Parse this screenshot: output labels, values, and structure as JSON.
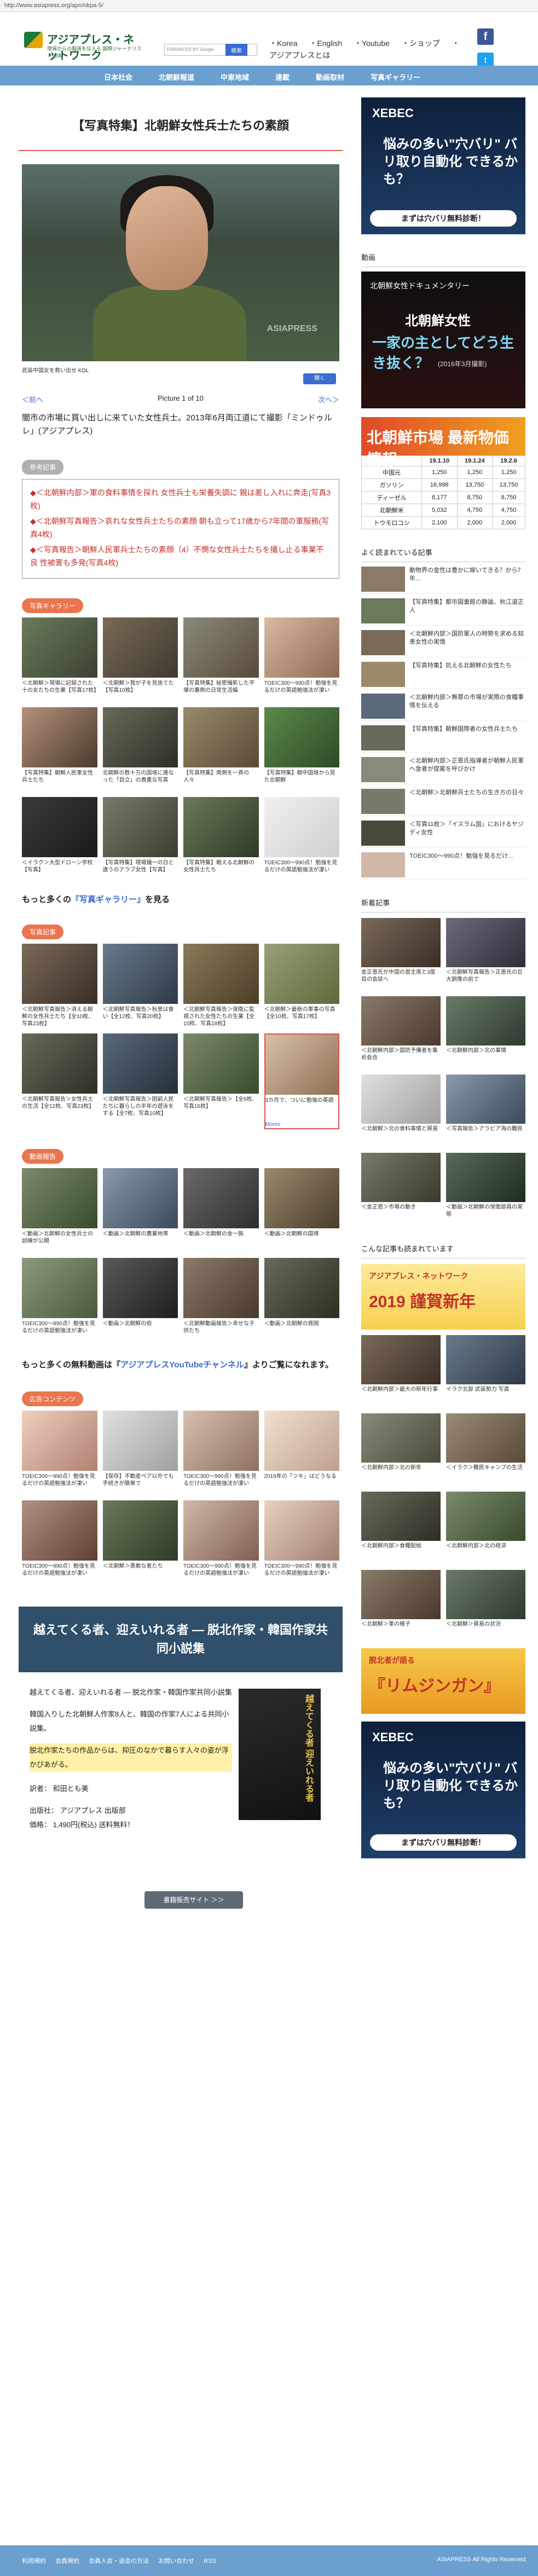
{
  "url": "http://www.asiapress.org/apn/nkpa-5/",
  "brand": {
    "name": "アジアプレス・ネットワーク",
    "tagline": "現場からの報道を伝える 国際ジャーナリスト団体"
  },
  "search": {
    "placeholder": "ENHANCED BY Google",
    "button": "検索"
  },
  "toplinks": [
    "・Korea",
    "・English",
    "・Youtube",
    "・ショップ",
    "・アジアプレスとは"
  ],
  "nav": [
    "日本社会",
    "北朝鮮報道",
    "中東地域",
    "連載",
    "動画取材",
    "写真ギャラリー"
  ],
  "article": {
    "title": "【写真特集】北朝鮮女性兵士たちの素顔",
    "watermark": "ASIAPRESS",
    "ad_text": "武装中国女を救い出せ KDL",
    "ad_button": "開く",
    "pager_prev": "＜前へ",
    "pager_count": "Picture 1 of 10",
    "pager_next": "次へ＞",
    "caption": "闇市の市場に買い出しに来ていた女性兵士。2013年6月両江道にて撮影「ミンドゥルレ」(アジアプレス)"
  },
  "refs": {
    "label": "参考記事",
    "items": [
      "◆＜北朝鮮内部＞軍の食料事情を探れ 女性兵士も栄養失調に 親は差し入れに奔走(写真3枚)",
      "◆＜北朝鮮写真報告＞哀れな女性兵士たちの素顔 朝も立って17歳から7年間の軍服務(写真4枚)",
      "◆＜写真報告＞朝鮮人民軍兵士たちの素顔（4）不憫な女性兵士たちを撮し止る事業不良 性被害も多発(写真4枚)"
    ]
  },
  "gallery1": {
    "label": "写真ギャラリー",
    "items": [
      "＜北朝鮮＞現場に記録された十の女たちの生業【写真17枚】",
      "＜北朝鮮＞我が子を見捨てた【写真10枚】",
      "【写真特集】秘密撮影した平壌の裏側の日常生活編",
      "TOEIC300〜990点！勉強を見るだけの英語勉強法が凄い",
      "【写真特集】朝鮮人民軍女性兵士たち",
      "北朝鮮の数十万の国境に連なった「目立」の貴重な写真",
      "【写真特集】両側を一斉の人々",
      "【写真特集】朝中国境から見た北朝鮮",
      "＜イラク＞大型ドローン学校【写真】",
      "【写真特集】現場撮一の日と違うのアラブ女性【写真】",
      "【写真特集】戦える北朝鮮の女性兵士たち",
      "TOEIC300〜990点！勉強を見るだけの英語勉強法が凄い"
    ],
    "sponsor": "Sponsored"
  },
  "more": {
    "prefix": "もっと多くの",
    "link": "『写真ギャラリー』",
    "suffix": "を見る"
  },
  "gallery2": {
    "label": "写真記事",
    "items": [
      "＜北朝鮮写真報告＞消える朝鮮の女性兵士たち【全10枚、写真23枚】",
      "＜北朝鮮写真報告＞秋景は食い【全12枚、写真20枚】",
      "＜北朝鮮写真報告＞保衛に監視された女性たちの生業【全10枚、写真18枚】",
      "＜北朝鮮＞最新の軍事の写真【全10枚、写真17枚】",
      "＜北朝鮮写真報告＞女性兵士の生活【全12枚、写真23枚】",
      "＜北朝鮮写真報告＞困窮人民たちに暮らしの半年の遊泳をする【全7枚、写真10枚】",
      "＜北朝鮮写真報告＞【全6枚、写真16枚】",
      "3カ月で、ついに勉強の英語"
    ],
    "more_label": "Mores"
  },
  "gallery3": {
    "label": "動画報告",
    "items": [
      "＜動画＞北朝鮮の女性兵士の訓練が公開",
      "＜動画＞北朝鮮の農業地帯",
      "＜動画＞北朝鮮の金一族",
      "＜動画＞北朝鮮の国境",
      "TOEIC300〜990点！勉強を見るだけの英語勉強法が凄い",
      "＜動画＞北朝鮮の街",
      "＜北朝鮮動画報告＞幸せな子供たち",
      "＜動画＞北朝鮮の貧困"
    ]
  },
  "youtube": {
    "prefix": "もっと多くの無料動画は『",
    "link": "アジアプレスYouTubeチャンネル",
    "suffix": "』よりご覧になれます。"
  },
  "sponsored": {
    "label": "広告コンテンツ",
    "items": [
      "TOEIC300〜990点！勉強を見るだけの英語勉強法が凄い",
      "【保存】不動産ペア以外でも手続きが簡単で",
      "TOEIC300〜990点！勉強を見るだけの英語勉強法が凄い",
      "2019年の「ツキ」はどうなる",
      "TOEIC300〜990点！勉強を見るだけの英語勉強法が凄い",
      "＜北朝鮮＞勇敢な者たち",
      "TOEIC300〜990点！勉強を見るだけの英語勉強法が凄い",
      "TOEIC300〜990点！勉強を見るだけの英語勉強法が凄い"
    ]
  },
  "book": {
    "title": "越えてくる者、迎えいれる者 ― 脱北作家・韓国作家共同小説集",
    "lines": [
      "越えてくる者、迎えいれる者 ― 脱北作家・韓国作家共同小説集",
      "韓国入りした北朝鮮人作家8人と、韓国の作家7人による共同小説集。",
      "脱北作家たちの作品からは、抑圧のなかで暮らす人々の姿が浮かびあがる。"
    ],
    "translator": "訳者： 和田とも美",
    "publisher": "出版社： アジアプレス 出版部",
    "price": "価格： 1,490円(税込) 送料無料！",
    "cover_text": "越えてくる者 迎えいれる者",
    "button": "書籍販売サイト ＞＞"
  },
  "side": {
    "banner": {
      "brand": "XEBEC",
      "text": "悩みの多い\"穴バリ\" バリ取り自動化 できるかも？",
      "button": "まずは穴バリ無料診断！"
    },
    "video_head": "動画",
    "video": {
      "brand": "北朝鮮女性ドキュメンタリー",
      "line1": "北朝鮮女性",
      "line2": "一家の主としてどう生き抜く？",
      "date": "(2016年3月撮影)"
    },
    "price": {
      "title": "北朝鮮市場 最新物価情報",
      "headers": [
        "",
        "19.1.10",
        "19.1.24",
        "19.2.6"
      ],
      "rows": [
        [
          "中国元",
          "1,250",
          "1,250",
          "1,250"
        ],
        [
          "ガソリン",
          "16,998",
          "13,750",
          "13,750"
        ],
        [
          "ディーゼル",
          "8,177",
          "8,750",
          "8,750"
        ],
        [
          "北朝鮮米",
          "5,032",
          "4,750",
          "4,750"
        ],
        [
          "トウモロコシ",
          "2,100",
          "2,000",
          "2,000"
        ]
      ]
    },
    "popular_head": "よく読まれている記事",
    "popular": [
      "動物界の金性は豊かに嫁いできる？から7年…",
      "【写真特集】都市図書館の静謐、秋江道正人",
      "＜北朝鮮内部＞国防軍人の時勢を求める知恵女性の実情",
      "【写真特集】抗える北朝鮮の女性たち",
      "＜北朝鮮内部＞無罪の市場が実際の食糧事情を伝える",
      "【写真特集】朝鮮国際者の女性兵士たち",
      "＜北朝鮮内部＞正恩氏指導者が朝鮮人民軍へ金者が提案を呼びかけ",
      "＜北朝鮮＞北朝鮮兵士たちの生き方の日々",
      "＜写真11枚＞「イスラム国」におけるヤジディ女性",
      "TOEIC300〜990点！勉強を見るだけ..."
    ],
    "new_head": "新着記事",
    "new": [
      "金正恩氏が中国の習主席と3度目の会談へ",
      "＜北朝鮮写真報告＞正恩氏の巨大銅像の前で",
      "＜北朝鮮内部＞国防予備者を集め会合",
      "＜北朝鮮内部＞北の事情",
      "＜北朝鮮＞北の食料事情と貿易",
      "＜写真報告＞アラビア海の難民",
      "＜金正恩＞市場の動き",
      "＜動画＞北朝鮮の保衛部員の実態"
    ],
    "read_head": "こんな記事も読まれています",
    "pr": {
      "a": "アジアプレス・ネットワーク",
      "b": "2019 謹賀新年"
    },
    "read": [
      "＜北朝鮮内部＞最大の新年行事",
      "イラク北部 武装勢力 写真",
      "＜北朝鮮内部＞北の新年",
      "＜イラク＞難民キャンプの生活",
      "＜北朝鮮内部＞食糧配給",
      "＜北朝鮮内部＞北の経済",
      "＜北朝鮮＞軍の様子",
      "＜北朝鮮＞貿易の状況"
    ],
    "pr2": {
      "a": "脱北者が語る",
      "b": "『リムジンガン』"
    },
    "banner2": {
      "brand": "XEBEC",
      "text": "悩みの多い\"穴バリ\" バリ取り自動化 できるかも？",
      "button": "まずは穴バリ無料診断！"
    }
  },
  "footer": {
    "links": [
      "利用規約",
      "会員規約",
      "会員入会・退会の方法",
      "お問い合わせ",
      "RSS"
    ],
    "copy": "ASIAPRESS All Rights Reserved."
  },
  "colors": {
    "nav": "#6a9fcf",
    "accent": "#e9764f",
    "link": "#3a6bd1",
    "ref": "#c4302b"
  }
}
